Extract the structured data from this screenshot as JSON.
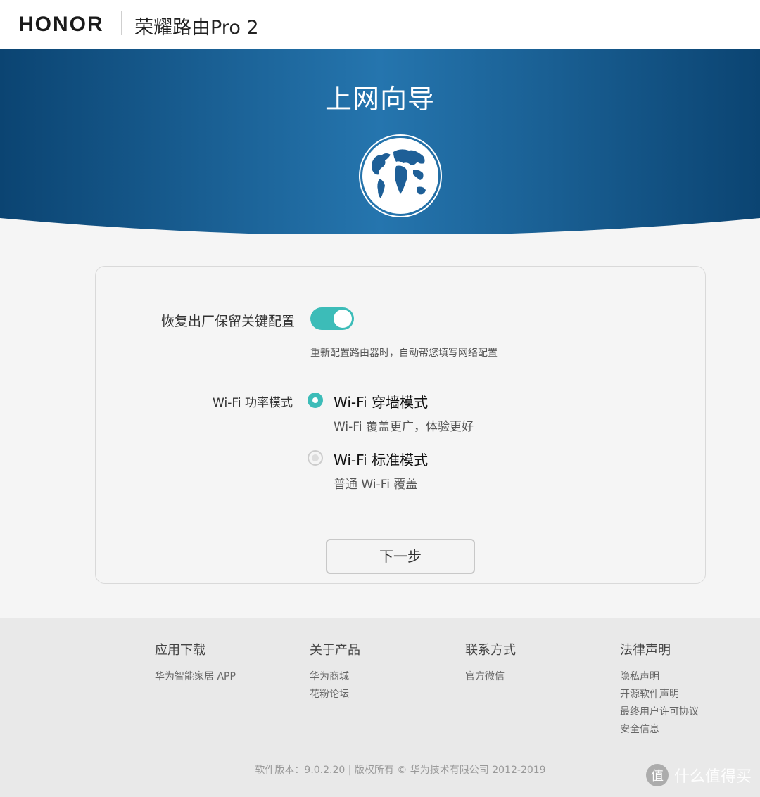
{
  "header": {
    "brand": "HONOR",
    "product": "荣耀路由Pro 2"
  },
  "banner": {
    "title": "上网向导",
    "icon": "globe-icon",
    "gradient": [
      "#0b4472",
      "#2575ae"
    ]
  },
  "settings": {
    "reset_label": "恢复出厂保留关键配置",
    "reset_toggle_on": true,
    "reset_hint": "重新配置路由器时，自动帮您填写网络配置",
    "wifi_mode_label": "Wi-Fi 功率模式",
    "options": [
      {
        "title": "Wi-Fi 穿墙模式",
        "desc": "Wi-Fi 覆盖更广，体验更好",
        "selected": true
      },
      {
        "title": "Wi-Fi 标准模式",
        "desc": "普通 Wi-Fi 覆盖",
        "selected": false
      }
    ],
    "next_button": "下一步",
    "accent": "#3cbcb8"
  },
  "footer": {
    "columns": [
      {
        "title": "应用下载",
        "links": [
          "华为智能家居 APP"
        ]
      },
      {
        "title": "关于产品",
        "links": [
          "华为商城",
          "花粉论坛"
        ]
      },
      {
        "title": "联系方式",
        "links": [
          "官方微信"
        ]
      },
      {
        "title": "法律声明",
        "links": [
          "隐私声明",
          "开源软件声明",
          "最终用户许可协议",
          "安全信息"
        ]
      }
    ],
    "copyright": "软件版本：9.0.2.20 | 版权所有 © 华为技术有限公司 2012-2019"
  },
  "watermark": {
    "icon_char": "值",
    "text": "什么值得买"
  }
}
